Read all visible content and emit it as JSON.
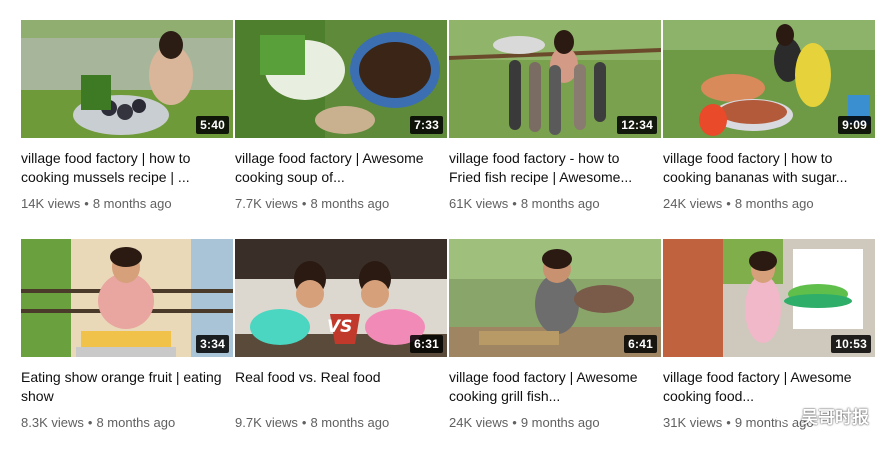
{
  "videos": [
    {
      "title": "village food factory | how to cooking mussels recipe | ...",
      "duration": "5:40",
      "views": "14K views",
      "age": "8 months ago"
    },
    {
      "title": "village food factory | Awesome cooking soup of...",
      "duration": "7:33",
      "views": "7.7K views",
      "age": "8 months ago"
    },
    {
      "title": "village food factory - how to Fried fish recipe | Awesome...",
      "duration": "12:34",
      "views": "61K views",
      "age": "8 months ago"
    },
    {
      "title": "village food factory | how to cooking bananas with sugar...",
      "duration": "9:09",
      "views": "24K views",
      "age": "8 months ago"
    },
    {
      "title": "Eating show orange fruit | eating show",
      "duration": "3:34",
      "views": "8.3K views",
      "age": "8 months ago"
    },
    {
      "title": "Real food vs. Real food",
      "duration": "6:31",
      "views": "9.7K views",
      "age": "8 months ago"
    },
    {
      "title": "village food factory | Awesome cooking grill fish...",
      "duration": "6:41",
      "views": "24K views",
      "age": "9 months ago"
    },
    {
      "title": "village food factory | Awesome cooking food...",
      "duration": "10:53",
      "views": "31K views",
      "age": "9 months ago"
    }
  ],
  "watermark": {
    "text": "吴哥时报",
    "icon": "wechat-icon"
  },
  "thumb_vs_badge": "VS"
}
